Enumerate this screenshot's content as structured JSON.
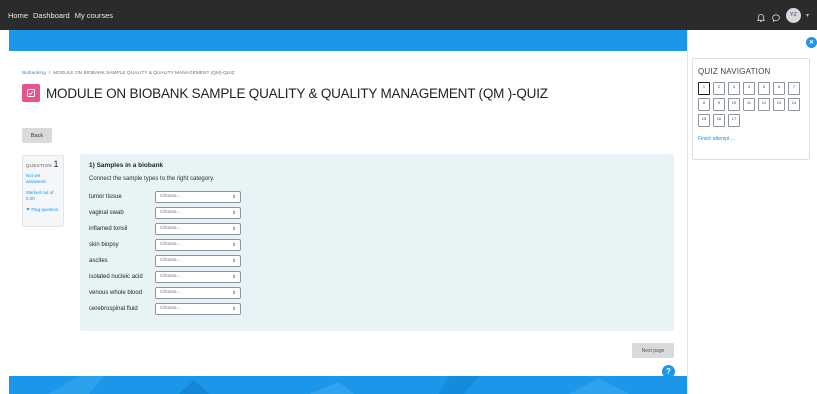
{
  "navbar": {
    "links": [
      "Home",
      "Dashboard",
      "My courses"
    ],
    "avatar_initials": "YZ",
    "icons": [
      "bell-icon",
      "chat-icon"
    ]
  },
  "breadcrumb": {
    "course": "Biobanking",
    "current": "MODULE ON BIOBANK SAMPLE QUALITY & QUALITY MANAGEMENT (QM)-QUIZ"
  },
  "page": {
    "title": "MODULE ON BIOBANK SAMPLE QUALITY & QUALITY MANAGEMENT (QM )-QUIZ",
    "back_label": "Back",
    "next_label": "Next page",
    "help_label": "?"
  },
  "question": {
    "label": "QUESTION",
    "number": "1",
    "state": "Not yet answered",
    "grade": "Marked out of 5.00",
    "flag_label": "Flag question",
    "title": "1) Samples in a biobank",
    "text": "Connect the sample types to the right category.",
    "stems": [
      "tumor tissue",
      "vaginal swab",
      "inflamed tonsil",
      "skin biopsy",
      "ascites",
      "isolated nucleic acid",
      "venous whole blood",
      "cerebrospinal fluid"
    ],
    "select_value": "Choose..."
  },
  "quiz_nav": {
    "title": "QUIZ NAVIGATION",
    "numbers": [
      "1",
      "2",
      "3",
      "4",
      "5",
      "6",
      "7",
      "8",
      "9",
      "10",
      "11",
      "12",
      "13",
      "14",
      "15",
      "16",
      "17"
    ],
    "current": "1",
    "finish_label": "Finish attempt ..."
  },
  "colors": {
    "accent": "#1b96e8",
    "quiz_icon": "#e6538f",
    "navbar": "#2b2b2b",
    "question_bg": "#e7f3f5"
  }
}
